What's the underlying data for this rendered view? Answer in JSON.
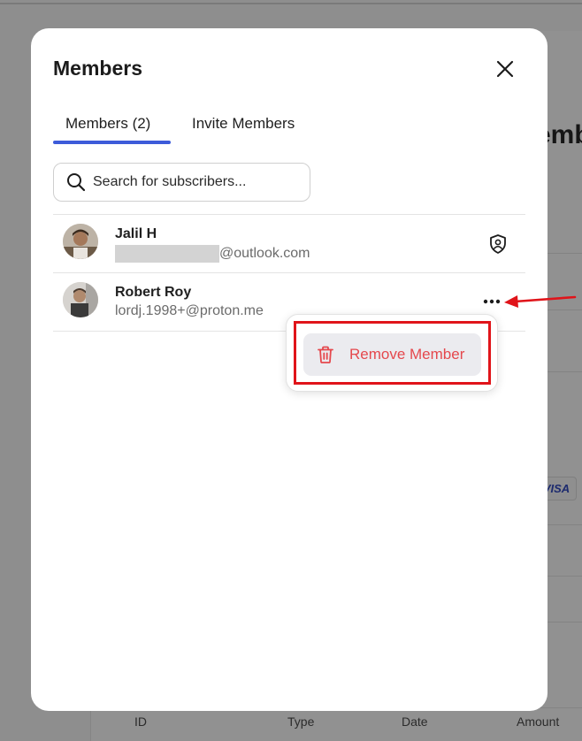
{
  "background": {
    "heading_fragment": "emb",
    "card_brand": "VISA",
    "table_headers": [
      "ID",
      "Type",
      "Date",
      "Amount"
    ]
  },
  "modal": {
    "title": "Members",
    "close_icon": "close-icon",
    "tabs": [
      {
        "label": "Members (2)",
        "active": true
      },
      {
        "label": "Invite Members",
        "active": false
      }
    ],
    "search": {
      "placeholder": "Search for subscribers...",
      "value": "",
      "icon": "search-icon"
    },
    "members": [
      {
        "name": "Jalil H",
        "email_visible": "@outlook.com",
        "email_redacted": true,
        "action_icon": "shield-user-icon"
      },
      {
        "name": "Robert Roy",
        "email_visible": "lordj.1998+@proton.me",
        "email_redacted": false,
        "action_icon": "more-dots-icon"
      }
    ],
    "dropdown": {
      "items": [
        {
          "label": "Remove Member",
          "icon": "trash-icon"
        }
      ]
    }
  },
  "colors": {
    "accent": "#3d5bd9",
    "danger": "#e5484d",
    "annotation": "#e0141a",
    "overlay": "#8e8e8e"
  }
}
